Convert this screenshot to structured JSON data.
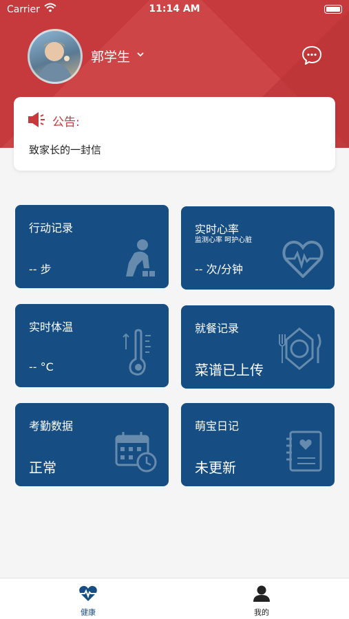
{
  "status_bar": {
    "carrier": "Carrier",
    "time": "11:14 AM"
  },
  "header": {
    "username": "郭学生"
  },
  "notice": {
    "title": "公告:",
    "message": "致家长的一封信"
  },
  "cards": {
    "activity": {
      "title": "行动记录",
      "value": "-- 步",
      "icon": "child-playing-icon"
    },
    "heart_rate": {
      "title": "实时心率",
      "subtitle": "监测心率 呵护心脏",
      "value": "-- 次/分钟",
      "icon": "heart-pulse-icon"
    },
    "temperature": {
      "title": "实时体温",
      "value": "-- °C",
      "icon": "thermometer-icon"
    },
    "meals": {
      "title": "就餐记录",
      "value": "菜谱已上传",
      "icon": "fork-knife-icon"
    },
    "attendance": {
      "title": "考勤数据",
      "value": "正常",
      "icon": "calendar-clock-icon"
    },
    "diary": {
      "title": "萌宝日记",
      "value": "未更新",
      "icon": "notebook-heart-icon"
    }
  },
  "tabbar": {
    "health": "健康",
    "mine": "我的"
  },
  "colors": {
    "brand_red": "#c63a3e",
    "card_blue": "#164d82",
    "tab_active": "#164d82"
  }
}
